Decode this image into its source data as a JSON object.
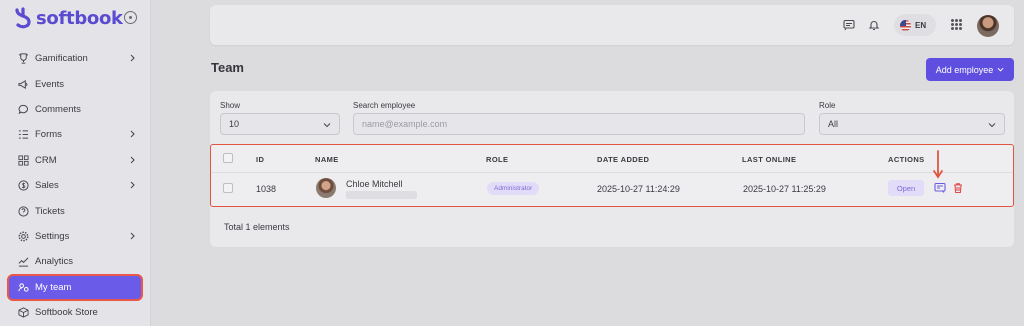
{
  "app": {
    "brand": "softbook"
  },
  "sidebar": {
    "items": [
      {
        "label": "Gamification",
        "icon": "trophy-icon",
        "has_children": true
      },
      {
        "label": "Events",
        "icon": "megaphone-icon",
        "has_children": false
      },
      {
        "label": "Comments",
        "icon": "comment-icon",
        "has_children": false
      },
      {
        "label": "Forms",
        "icon": "list-icon",
        "has_children": true
      },
      {
        "label": "CRM",
        "icon": "grid-icon",
        "has_children": true
      },
      {
        "label": "Sales",
        "icon": "dollar-icon",
        "has_children": true
      },
      {
        "label": "Tickets",
        "icon": "question-icon",
        "has_children": false
      },
      {
        "label": "Settings",
        "icon": "gear-icon",
        "has_children": true
      },
      {
        "label": "Analytics",
        "icon": "chart-icon",
        "has_children": false
      },
      {
        "label": "My team",
        "icon": "team-icon",
        "has_children": false,
        "active": true
      },
      {
        "label": "Softbook Store",
        "icon": "box-icon",
        "has_children": false
      }
    ]
  },
  "topbar": {
    "language": "EN"
  },
  "page": {
    "title": "Team",
    "add_button": "Add employee"
  },
  "filters": {
    "show_label": "Show",
    "show_value": "10",
    "search_label": "Search employee",
    "search_placeholder": "name@example.com",
    "role_label": "Role",
    "role_value": "All"
  },
  "table": {
    "headers": {
      "id": "ID",
      "name": "NAME",
      "role": "ROLE",
      "date_added": "DATE ADDED",
      "last_online": "LAST ONLINE",
      "actions": "ACTIONS"
    },
    "rows": [
      {
        "id": "1038",
        "name": "Chloe Mitchell",
        "role": "Administrator",
        "date_added": "2025-10-27 11:24:29",
        "last_online": "2025-10-27 11:25:29",
        "open_label": "Open"
      }
    ]
  },
  "footer": {
    "total": "Total 1 elements"
  },
  "colors": {
    "accent": "#5e4fe0",
    "active_nav": "#6a5ce8",
    "highlight": "#e2553f",
    "delete": "#e04b4b"
  }
}
